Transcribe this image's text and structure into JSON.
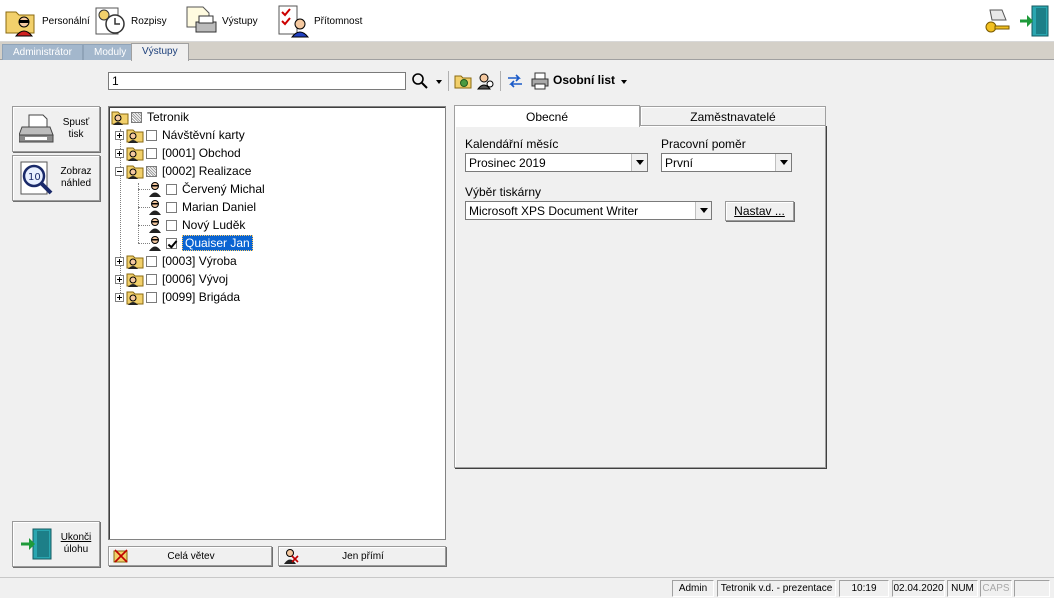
{
  "toolbar": {
    "items": [
      {
        "label": "Personální",
        "icon": "folder-person-icon"
      },
      {
        "label": "Rozpisy",
        "icon": "clock-schedule-icon"
      },
      {
        "label": "Výstupy",
        "icon": "printer-output-icon"
      },
      {
        "label": "Přítomnost",
        "icon": "checklist-person-icon"
      }
    ],
    "right_icons": [
      "key-icon",
      "exit-door-icon"
    ]
  },
  "nav_tabs": [
    {
      "label": "Administrátor",
      "active": false
    },
    {
      "label": "Moduly",
      "active": false
    },
    {
      "label": "Výstupy",
      "active": true
    }
  ],
  "search": {
    "value": "1"
  },
  "report_selector": {
    "label": "Osobní list"
  },
  "side_buttons": {
    "print": {
      "line1": "Spusť",
      "line2": "tisk"
    },
    "preview": {
      "line1": "Zobraz",
      "line2": "náhled"
    },
    "exit": {
      "line1": "Ukonči",
      "line2": "úlohu"
    }
  },
  "tree": {
    "root": "Tetronik",
    "nodes": [
      {
        "label": "Návštěvní karty"
      },
      {
        "label": "[0001] Obchod"
      },
      {
        "label": "[0002] Realizace"
      },
      {
        "label": "Červený Michal"
      },
      {
        "label": "Marian Daniel"
      },
      {
        "label": "Nový Luděk"
      },
      {
        "label": "Quaiser Jan"
      },
      {
        "label": "[0003] Výroba"
      },
      {
        "label": "[0006] Vývoj"
      },
      {
        "label": "[0099] Brigáda"
      }
    ],
    "buttons": {
      "whole_branch": "Celá větev",
      "direct_only": "Jen přímí"
    }
  },
  "panel": {
    "tabs": [
      {
        "label": "Obecné",
        "active": true
      },
      {
        "label": "Zaměstnavatelé",
        "active": false
      }
    ],
    "month": {
      "label": "Kalendářní měsíc",
      "value": "Prosinec 2019"
    },
    "employment": {
      "label": "Pracovní poměr",
      "value": "První"
    },
    "printer": {
      "label": "Výběr tiskárny",
      "value": "Microsoft XPS Document Writer",
      "setup_button": "Nastav ..."
    }
  },
  "status": {
    "user": "Admin",
    "company": "Tetronik v.d. - prezentace",
    "time": "10:19",
    "date": "02.04.2020",
    "num": "NUM",
    "caps": "CAPS"
  },
  "colors": {
    "selection": "#0a64d2",
    "nav_tab_inactive": "#a3b7cc",
    "nav_tab_active_text": "#1c3f7a"
  }
}
